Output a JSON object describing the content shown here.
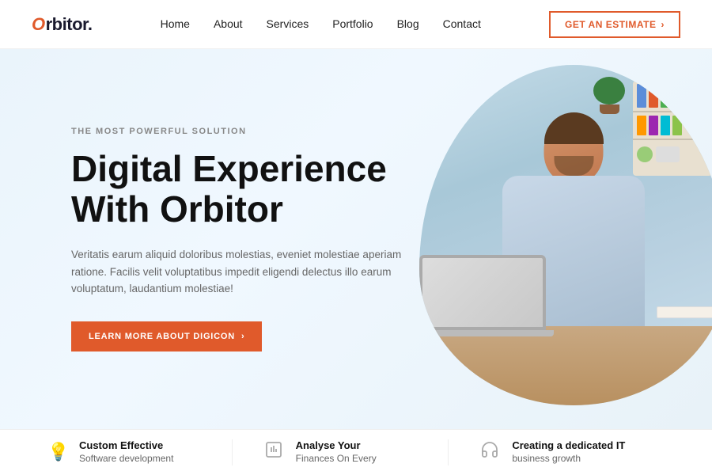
{
  "brand": {
    "logo_prefix": "O",
    "logo_text": "rbitor."
  },
  "navbar": {
    "links": [
      {
        "label": "Home",
        "href": "#"
      },
      {
        "label": "About",
        "href": "#"
      },
      {
        "label": "Services",
        "href": "#"
      },
      {
        "label": "Portfolio",
        "href": "#"
      },
      {
        "label": "Blog",
        "href": "#"
      },
      {
        "label": "Contact",
        "href": "#"
      }
    ],
    "cta_label": "GET AN ESTIMATE",
    "cta_arrow": "›"
  },
  "hero": {
    "subtitle": "THE MOST POWERFUL SOLUTION",
    "title_line1": "Digital Experience",
    "title_line2": "With Orbitor",
    "description": "Veritatis earum aliquid doloribus molestias, eveniet molestiae aperiam ratione. Facilis velit voluptatibus impedit eligendi delectus illo earum voluptatum, laudantium molestiae!",
    "cta_label": "LEARN MORE ABOUT DIGICON",
    "cta_arrow": "›"
  },
  "features": [
    {
      "icon": "💡",
      "title": "Custom Effective",
      "subtitle": "Software development"
    },
    {
      "icon": "📊",
      "title": "Analyse Your",
      "subtitle": "Finances On Every"
    },
    {
      "icon": "🎧",
      "title": "Creating a dedicated IT",
      "subtitle": "business growth"
    }
  ],
  "colors": {
    "accent": "#e05a2b",
    "text_primary": "#111",
    "text_muted": "#666",
    "nav_link": "#222"
  }
}
